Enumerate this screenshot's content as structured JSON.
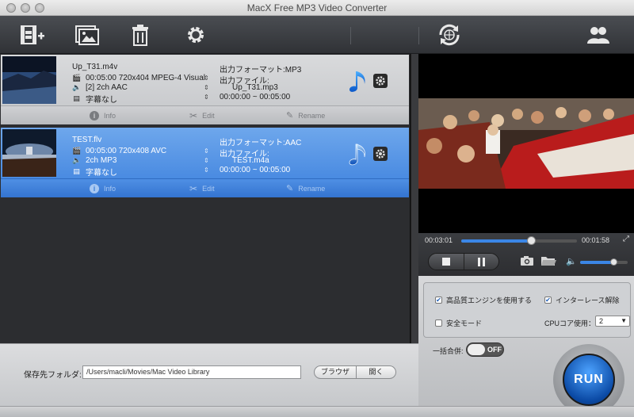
{
  "window": {
    "title": "MacX Free MP3 Video Converter"
  },
  "toolbar": {
    "add_video": "add-video-icon",
    "add_photo": "add-photo-icon",
    "delete": "trash-icon",
    "settings": "gear-icon",
    "update": "update-icon",
    "account": "users-icon"
  },
  "files": [
    {
      "name": "Up_T31.m4v",
      "video": "00:05:00 720x404 MPEG-4 Visual",
      "audio": "[2] 2ch AAC",
      "subtitle": "字幕なし",
      "output_format": "出力フォーマット:MP3",
      "output_file_label": "出力ファイル:",
      "output_file": "Up_T31.mp3",
      "range": "00:00:00 ~ 00:05:00",
      "actions": {
        "info": "Info",
        "edit": "Edit",
        "rename": "Rename"
      },
      "selected": false
    },
    {
      "name": "TEST.flv",
      "video": "00:05:00 720x408 AVC",
      "audio": "2ch MP3",
      "subtitle": "字幕なし",
      "output_format": "出力フォーマット:AAC",
      "output_file_label": "出力ファイル:",
      "output_file": "TEST.m4a",
      "range": "00:00:00 ~ 00:05:00",
      "actions": {
        "info": "Info",
        "edit": "Edit",
        "rename": "Rename"
      },
      "selected": true
    }
  ],
  "player": {
    "elapsed": "00:03:01",
    "remaining": "00:01:58",
    "progress": 0.6,
    "volume": 0.7
  },
  "options": {
    "hq_engine": {
      "label": "高品質エンジンを使用する",
      "checked": true
    },
    "deinterlace": {
      "label": "インターレース解除",
      "checked": true
    },
    "safe_mode": {
      "label": "安全モード",
      "checked": false
    },
    "cpu_label": "CPUコア使用：",
    "cpu_value": "2",
    "merge_label": "一括合併:",
    "merge_state": "OFF",
    "run_label": "RUN"
  },
  "output": {
    "folder_label": "保存先フォルダ:",
    "folder_path": "/Users/macli/Movies/Mac Video Library",
    "browse_label": "ブラウザ",
    "open_label": "開く"
  }
}
